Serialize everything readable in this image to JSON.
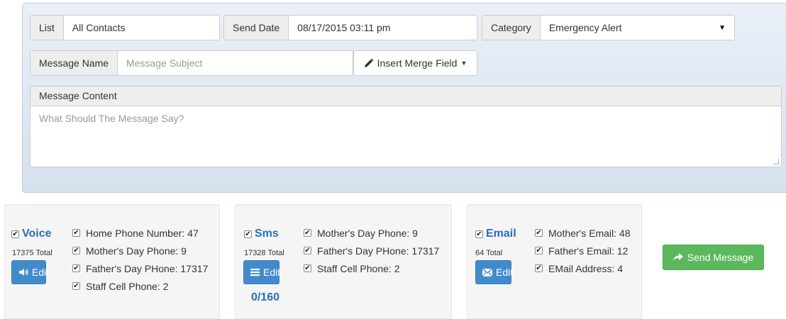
{
  "form": {
    "list": {
      "label": "List",
      "value": "All Contacts"
    },
    "send_date": {
      "label": "Send Date",
      "value": "08/17/2015 03:11 pm"
    },
    "category": {
      "label": "Category",
      "value": "Emergency Alert"
    },
    "message_name": {
      "label": "Message Name",
      "placeholder": "Message Subject"
    },
    "merge_field_button": "Insert Merge Field",
    "content": {
      "label": "Message Content",
      "placeholder": "What Should The Message Say?"
    }
  },
  "channels": {
    "voice": {
      "name": "Voice",
      "checked": true,
      "total": "17375 Total",
      "edit_label": "Edit",
      "icon": "volume-icon",
      "options": [
        {
          "label": "Home Phone Number: 47",
          "checked": true
        },
        {
          "label": "Mother's Day Phone: 9",
          "checked": true
        },
        {
          "label": "Father's Day PHone: 17317",
          "checked": true
        },
        {
          "label": "Staff Cell Phone: 2",
          "checked": true
        }
      ]
    },
    "sms": {
      "name": "Sms",
      "checked": true,
      "total": "17328 Total",
      "edit_label": "Edit",
      "icon": "list-icon",
      "counter": "0/160",
      "options": [
        {
          "label": "Mother's Day Phone: 9",
          "checked": true
        },
        {
          "label": "Father's Day PHone: 17317",
          "checked": true
        },
        {
          "label": "Staff Cell Phone: 2",
          "checked": true
        }
      ]
    },
    "email": {
      "name": "Email",
      "checked": true,
      "total": "64 Total",
      "edit_label": "Edit",
      "icon": "envelope-icon",
      "options": [
        {
          "label": "Mother's Email: 48",
          "checked": true
        },
        {
          "label": "Father's Email: 12",
          "checked": true
        },
        {
          "label": "EMail Address: 4",
          "checked": true
        }
      ]
    }
  },
  "send_button": "Send Message",
  "colors": {
    "primary": "#428bca",
    "success": "#5cb85c",
    "channel_title": "#2a6fb5"
  }
}
